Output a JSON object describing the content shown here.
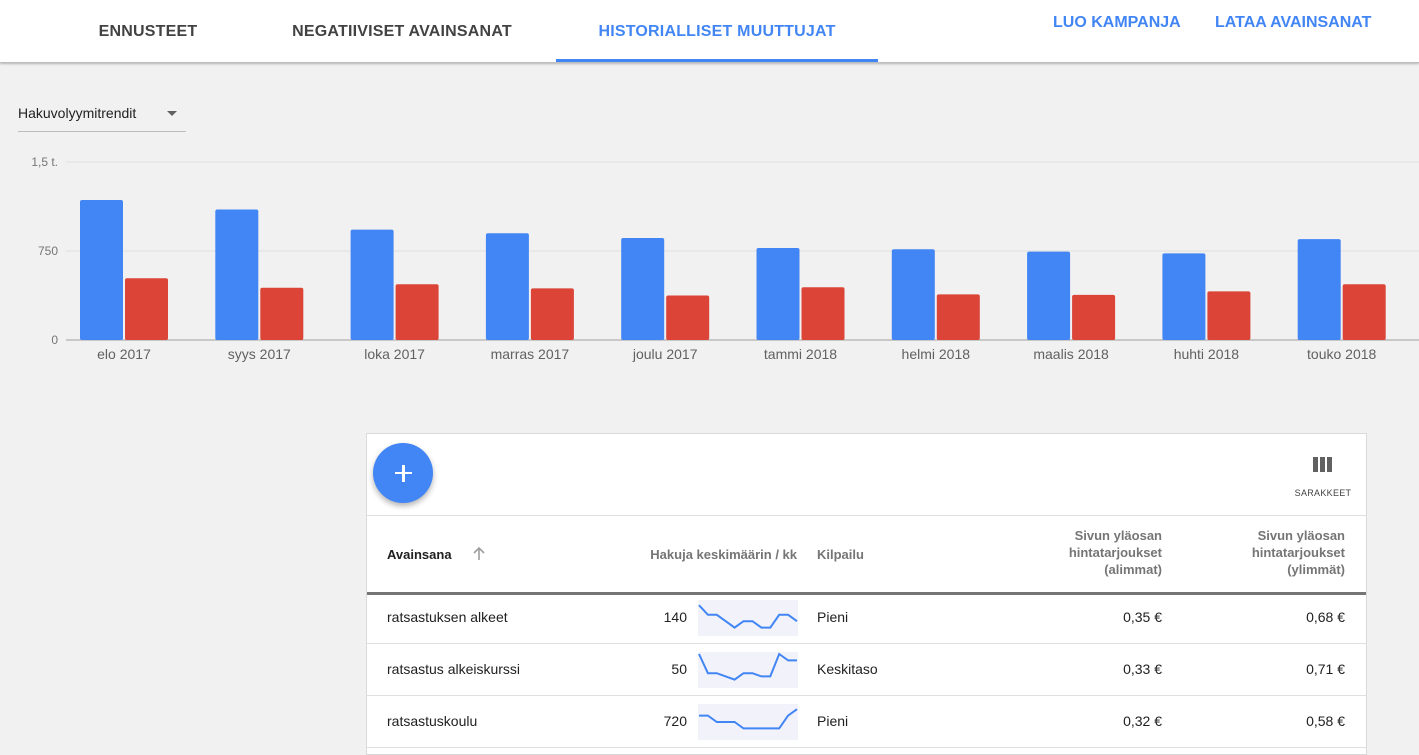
{
  "tabs": [
    {
      "label": "ENNUSTEET",
      "active": false
    },
    {
      "label": "NEGATIIVISET AVAINSANAT",
      "active": false
    },
    {
      "label": "HISTORIALLISET MUUTTUJAT",
      "active": true
    }
  ],
  "actions": {
    "create_campaign": "LUO KAMPANJA",
    "download_keywords": "LATAA AVAINSANAT"
  },
  "metric_select": {
    "selected": "Hakuvolyymitrendit"
  },
  "colors": {
    "accent": "#4285f4",
    "series_blue": "#4285f4",
    "series_red": "#db4437"
  },
  "chart_data": {
    "type": "bar",
    "categories": [
      "elo 2017",
      "syys 2017",
      "loka 2017",
      "marras 2017",
      "joulu 2017",
      "tammi 2018",
      "helmi 2018",
      "maalis 2018",
      "huhti 2018",
      "touko 2018"
    ],
    "series": [
      {
        "values": [
          1180,
          1100,
          930,
          900,
          860,
          775,
          765,
          745,
          730,
          850
        ]
      },
      {
        "values": [
          520,
          440,
          470,
          435,
          375,
          445,
          385,
          380,
          410,
          470
        ]
      }
    ],
    "yticks": [
      "0",
      "750",
      "1,5 t."
    ],
    "ylim": [
      0,
      1500
    ],
    "grid": true
  },
  "table": {
    "fab_icon": "plus-icon",
    "columns_button_label": "SARAKKEET",
    "headers": {
      "keyword": "Avainsana",
      "avg_searches": "Hakuja keskimäärin / kk",
      "competition": "Kilpailu",
      "bid_low": [
        "Sivun yläosan",
        "hintatarjoukset",
        "(alimmat)"
      ],
      "bid_high": [
        "Sivun yläosan",
        "hintatarjoukset",
        "(ylimmät)"
      ]
    },
    "rows": [
      {
        "keyword": "ratsastuksen alkeet",
        "searches": "140",
        "trend": [
          9,
          6,
          6,
          4,
          2,
          4,
          4,
          2,
          2,
          6,
          6,
          4
        ],
        "competition": "Pieni",
        "bid_low": "0,35 €",
        "bid_high": "0,68 €"
      },
      {
        "keyword": "ratsastus alkeiskurssi",
        "searches": "50",
        "trend": [
          10,
          4,
          4,
          3,
          2,
          4,
          4,
          3,
          3,
          10,
          8,
          8
        ],
        "competition": "Keskitaso",
        "bid_low": "0,33 €",
        "bid_high": "0,71 €"
      },
      {
        "keyword": "ratsastuskoulu",
        "searches": "720",
        "trend": [
          7,
          7,
          5,
          5,
          5,
          3,
          3,
          3,
          3,
          3,
          7,
          9
        ],
        "competition": "Pieni",
        "bid_low": "0,32 €",
        "bid_high": "0,58 €"
      }
    ]
  }
}
